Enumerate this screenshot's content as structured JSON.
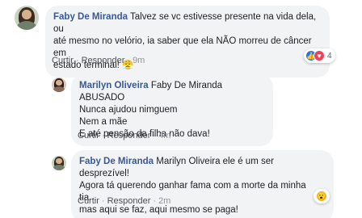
{
  "comments": [
    {
      "author": "Faby De Miranda",
      "lines": [
        "Talvez se vc estivesse presente na vida dela, ou",
        "até mesmo no velório, ia saber que ela NÃO morreu de câncer em",
        "estado terminal! 😤"
      ],
      "actions": {
        "like": "Curtir",
        "reply": "Responder",
        "time": "9m"
      },
      "reactions": {
        "icons": [
          "like-icon",
          "love-icon"
        ],
        "count": "4"
      }
    },
    {
      "author": "Marilyn Oliveira",
      "first_line_rest": "Faby De Miranda ABUSADO",
      "lines": [
        "Nunca ajudou nimguem",
        "Nem a mãe",
        "E até pensão da filha não dava!"
      ],
      "actions": {
        "like": "Curtir",
        "reply": "Responder",
        "time": "4m"
      }
    },
    {
      "author": "Faby De Miranda",
      "first_line_rest": "Marilyn Oliveira ele é um ser desprezível!",
      "lines": [
        "Agora tá querendo ganhar fama com a morte da minha tia...",
        "mas aqui se faz, aqui mesmo se paga!"
      ],
      "actions": {
        "like": "Curtir",
        "reply": "Responder",
        "time": "2m"
      },
      "reactions": {
        "icons": [
          "wow-icon"
        ],
        "count": ""
      }
    }
  ],
  "separator": "·",
  "colors": {
    "link": "#385898",
    "bubble": "#f2f3f5",
    "like": "#1877f2",
    "love": "#f33e58",
    "wow": "#f7b125"
  }
}
